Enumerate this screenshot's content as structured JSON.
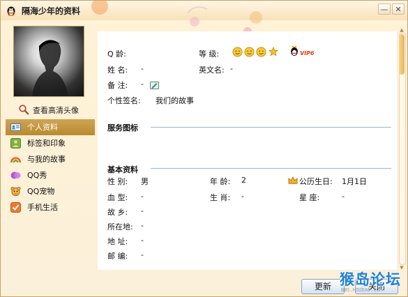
{
  "window": {
    "title": "隔海少年的资料",
    "controls": {
      "minimize": "—",
      "close": "✕"
    }
  },
  "sidebar": {
    "hd_avatar_link": "查看高清头像",
    "items": [
      {
        "label": "个人资料",
        "icon": "id-card-icon",
        "active": true
      },
      {
        "label": "标签和印象",
        "icon": "tag-user-icon",
        "active": false
      },
      {
        "label": "与我的故事",
        "icon": "rainbow-icon",
        "active": false
      },
      {
        "label": "QQ秀",
        "icon": "qq-show-icon",
        "active": false
      },
      {
        "label": "QQ宠物",
        "icon": "pet-icon",
        "active": false
      },
      {
        "label": "手机生活",
        "icon": "phone-check-icon",
        "active": false
      }
    ]
  },
  "profile": {
    "qq_age_label": "Q 龄:",
    "qq_age_value": "",
    "level_label": "等 级:",
    "vip_badge": "VIP6",
    "name_label": "姓 名:",
    "name_value": "-",
    "english_name_label": "英文名:",
    "english_name_value": "-",
    "remark_label": "备 注:",
    "remark_value": "-",
    "signature_label": "个性签名:",
    "signature_value": "我们的故事"
  },
  "service_section": {
    "title": "服务图标"
  },
  "basic_info": {
    "title": "基本资料",
    "gender_label": "性 别:",
    "gender_value": "男",
    "age_label": "年 龄:",
    "age_value": "2",
    "birthday_label": "公历生日:",
    "birthday_value": "1月1日",
    "blood_label": "血 型:",
    "blood_value": "-",
    "zodiac_label": "生 肖:",
    "zodiac_value": "-",
    "constellation_label": "星 座:",
    "constellation_value": "-",
    "hometown_label": "故 乡:",
    "hometown_value": "-",
    "location_label": "所在地:",
    "location_value": "-",
    "address_label": "地 址:",
    "address_value": "-",
    "postcode_label": "邮 编:",
    "postcode_value": "-"
  },
  "footer": {
    "refresh_label": "更新",
    "close_label": "关闭",
    "watermark_big": "猴岛论坛",
    "watermark_small": "BBS.HOUDAO.COM"
  }
}
